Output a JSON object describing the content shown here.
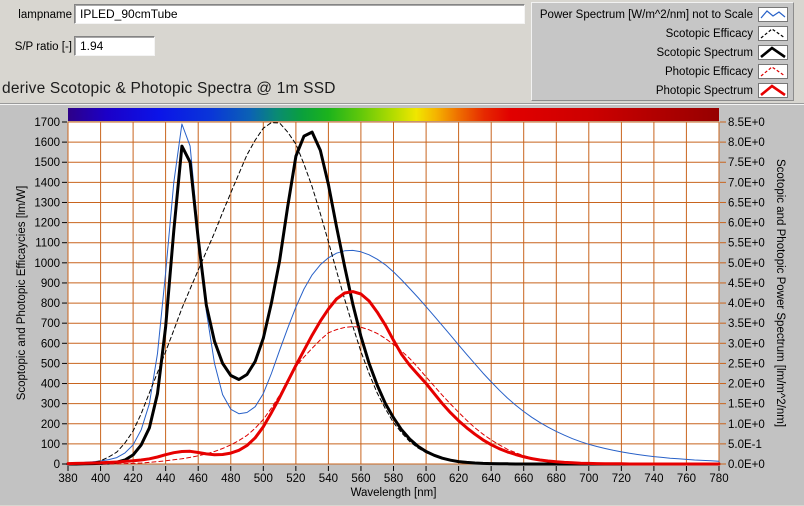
{
  "header": {
    "lampname_label": "lampname",
    "lampname_value": "IPLED_90cmTube",
    "sp_ratio_label": "S/P ratio [-]",
    "sp_ratio_value": "1.94",
    "title": "derive Scotopic & Photopic Spectra @ 1m SSD"
  },
  "chart_data": {
    "type": "line",
    "xlabel": "Wavelength [nm]",
    "ylabel_left": "Scoptopic and Photopic Efficaycies [lm/W]",
    "ylabel_right": "Scotopic and Photopic Power Spectrum [lm/m^2/nm]",
    "x_range": [
      380,
      780
    ],
    "y_left_range": [
      0,
      1700
    ],
    "y_right_range": [
      0,
      8.5
    ],
    "grid": true,
    "grid_color": "#c8641e",
    "legend_position": "top-right",
    "x_ticks": [
      380,
      400,
      420,
      440,
      460,
      480,
      500,
      520,
      540,
      560,
      580,
      600,
      620,
      640,
      660,
      680,
      700,
      720,
      740,
      760,
      780
    ],
    "y_left_ticks": [
      "1700",
      "1600",
      "1500",
      "1400",
      "1300",
      "1200",
      "1100",
      "1000",
      "900",
      "800",
      "700",
      "600",
      "500",
      "400",
      "300",
      "200",
      "100",
      "0"
    ],
    "y_right_ticks": [
      "8.5E+0",
      "8.0E+0",
      "7.5E+0",
      "7.0E+0",
      "6.5E+0",
      "6.0E+0",
      "5.5E+0",
      "5.0E+0",
      "4.5E+0",
      "4.0E+0",
      "3.5E+0",
      "3.0E+0",
      "2.5E+0",
      "2.0E+0",
      "1.5E+0",
      "1.0E+0",
      "5.0E-1",
      "0.0E+0"
    ],
    "wavelengths": [
      380,
      385,
      390,
      395,
      400,
      405,
      410,
      415,
      420,
      425,
      430,
      435,
      440,
      445,
      450,
      455,
      460,
      465,
      470,
      475,
      480,
      485,
      490,
      495,
      500,
      505,
      510,
      515,
      520,
      525,
      530,
      535,
      540,
      545,
      550,
      555,
      560,
      565,
      570,
      575,
      580,
      585,
      590,
      595,
      600,
      605,
      610,
      615,
      620,
      625,
      630,
      635,
      640,
      645,
      650,
      655,
      660,
      665,
      670,
      675,
      680,
      685,
      690,
      695,
      700,
      705,
      710,
      715,
      720,
      725,
      730,
      735,
      740,
      745,
      750,
      755,
      760,
      765,
      770,
      775,
      780
    ],
    "series": [
      {
        "name": "Power Spectrum [W/m^2/nm] not to Scale",
        "color": "#2861c8",
        "width": 1,
        "dash": null,
        "values": [
          4,
          6,
          8,
          11,
          15,
          22,
          32,
          55,
          95,
          170,
          300,
          550,
          950,
          1400,
          1690,
          1580,
          1150,
          760,
          500,
          345,
          272,
          250,
          256,
          285,
          350,
          450,
          565,
          675,
          780,
          870,
          940,
          990,
          1025,
          1048,
          1060,
          1062,
          1055,
          1040,
          1018,
          990,
          955,
          915,
          872,
          828,
          782,
          735,
          688,
          640,
          592,
          545,
          498,
          452,
          408,
          367,
          328,
          293,
          261,
          232,
          206,
          183,
          162,
          143,
          126,
          111,
          98,
          87,
          77,
          68,
          60,
          53,
          47,
          42,
          37,
          33,
          29,
          26,
          23,
          20,
          18,
          16,
          14
        ]
      },
      {
        "name": "Scotopic Efficacy",
        "color": "#000000",
        "width": 1,
        "dash": "4,3",
        "values": [
          1,
          2,
          4,
          8,
          16,
          35,
          59,
          105,
          164,
          250,
          354,
          455,
          558,
          665,
          774,
          870,
          964,
          1056,
          1149,
          1250,
          1348,
          1443,
          1537,
          1610,
          1669,
          1697,
          1695,
          1650,
          1590,
          1490,
          1379,
          1245,
          1105,
          960,
          818,
          685,
          559,
          450,
          353,
          275,
          206,
          155,
          111,
          80,
          56,
          40,
          27,
          19,
          13,
          9,
          6,
          4,
          3,
          2,
          1,
          1,
          1,
          0,
          0,
          0,
          0,
          0,
          0,
          0,
          0,
          0,
          0,
          0,
          0,
          0,
          0,
          0,
          0,
          0,
          0,
          0,
          0,
          0,
          0,
          0,
          0
        ]
      },
      {
        "name": "Scotopic Spectrum",
        "color": "#000000",
        "width": 3,
        "dash": null,
        "values": [
          0,
          0,
          1,
          2,
          3,
          5,
          9,
          20,
          45,
          95,
          180,
          350,
          680,
          1160,
          1580,
          1500,
          1120,
          790,
          610,
          500,
          440,
          420,
          445,
          510,
          625,
          800,
          1010,
          1280,
          1530,
          1630,
          1650,
          1560,
          1390,
          1180,
          980,
          795,
          635,
          500,
          392,
          300,
          230,
          170,
          124,
          88,
          62,
          43,
          29,
          19,
          12,
          8,
          5,
          3,
          2,
          1,
          1,
          0,
          0,
          0,
          0,
          0,
          0,
          0,
          0,
          0,
          0,
          0,
          0,
          0,
          0,
          0,
          0,
          0,
          0,
          0,
          0,
          0,
          0,
          0,
          0,
          0,
          0
        ]
      },
      {
        "name": "Photopic Efficacy",
        "color": "#dd0000",
        "width": 1,
        "dash": "4,3",
        "values": [
          0,
          0,
          0,
          0,
          0,
          0,
          1,
          2,
          3,
          5,
          8,
          12,
          16,
          21,
          26,
          33,
          41,
          50,
          62,
          77,
          95,
          117,
          142,
          178,
          221,
          278,
          342,
          412,
          484,
          532,
          575,
          617,
          652,
          668,
          679,
          683,
          680,
          667,
          649,
          624,
          594,
          561,
          524,
          480,
          433,
          387,
          342,
          298,
          257,
          217,
          180,
          148,
          120,
          95,
          73,
          56,
          42,
          31,
          22,
          16,
          11,
          8,
          6,
          4,
          3,
          2,
          1,
          1,
          1,
          0,
          0,
          0,
          0,
          0,
          0,
          0,
          0,
          0,
          0,
          0,
          0
        ]
      },
      {
        "name": "Photopic Spectrum",
        "color": "#e60000",
        "width": 3,
        "dash": null,
        "values": [
          2,
          3,
          4,
          5,
          6,
          8,
          10,
          13,
          16,
          20,
          26,
          35,
          46,
          56,
          62,
          63,
          57,
          50,
          46,
          47,
          54,
          68,
          92,
          130,
          185,
          255,
          330,
          410,
          490,
          565,
          640,
          710,
          770,
          820,
          850,
          857,
          845,
          810,
          755,
          690,
          615,
          545,
          490,
          445,
          400,
          350,
          300,
          255,
          215,
          180,
          148,
          120,
          96,
          76,
          60,
          47,
          36,
          27,
          20,
          15,
          11,
          8,
          6,
          4,
          3,
          2,
          1,
          1,
          1,
          0,
          0,
          0,
          0,
          0,
          0,
          0,
          0,
          0,
          0,
          0,
          0
        ]
      }
    ],
    "spectrum_bar": {
      "stops": [
        {
          "pos": 0.0,
          "color": "#2d0088"
        },
        {
          "pos": 0.06,
          "color": "#1b00c8"
        },
        {
          "pos": 0.14,
          "color": "#0b14e8"
        },
        {
          "pos": 0.22,
          "color": "#0a36d8"
        },
        {
          "pos": 0.28,
          "color": "#0b62b4"
        },
        {
          "pos": 0.32,
          "color": "#0a8a74"
        },
        {
          "pos": 0.36,
          "color": "#0aa03c"
        },
        {
          "pos": 0.4,
          "color": "#1cb31c"
        },
        {
          "pos": 0.45,
          "color": "#62c80a"
        },
        {
          "pos": 0.5,
          "color": "#b4dc00"
        },
        {
          "pos": 0.535,
          "color": "#f0e600"
        },
        {
          "pos": 0.565,
          "color": "#f5b400"
        },
        {
          "pos": 0.6,
          "color": "#ee6e00"
        },
        {
          "pos": 0.64,
          "color": "#e62800"
        },
        {
          "pos": 0.68,
          "color": "#e10000"
        },
        {
          "pos": 0.8,
          "color": "#cd0000"
        },
        {
          "pos": 0.9,
          "color": "#b20000"
        },
        {
          "pos": 1.0,
          "color": "#960000"
        }
      ]
    }
  }
}
